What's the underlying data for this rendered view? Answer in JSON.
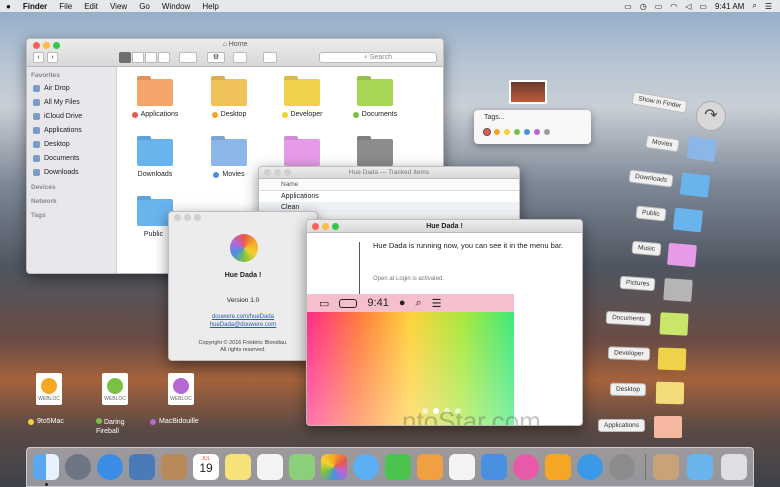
{
  "menubar": {
    "apple": "",
    "app": "Finder",
    "items": [
      "File",
      "Edit",
      "View",
      "Go",
      "Window",
      "Help"
    ],
    "time": "9:41 AM"
  },
  "finder": {
    "title": "Home",
    "search_placeholder": "Search",
    "sidebar": {
      "favorites_head": "Favorites",
      "favorites": [
        "Air Drop",
        "All My Files",
        "iCloud Drive",
        "Applications",
        "Desktop",
        "Documents",
        "Downloads"
      ],
      "devices_head": "Devices",
      "network_head": "Network",
      "tags_head": "Tags"
    },
    "folders": [
      {
        "label": "Applications",
        "color": "#f5a56a",
        "dot": "#e8574e"
      },
      {
        "label": "Desktop",
        "color": "#f0c35a",
        "dot": "#f5a623"
      },
      {
        "label": "Developer",
        "color": "#f0d24a",
        "dot": "#f2d230"
      },
      {
        "label": "Documents",
        "color": "#a6d653",
        "dot": "#7ac143"
      },
      {
        "label": "Downloads",
        "color": "#6ab4ee",
        "dot": ""
      },
      {
        "label": "Movies",
        "color": "#8bb7e8",
        "dot": "#4a90e2"
      },
      {
        "label": "",
        "color": "#e69be8",
        "dot": ""
      },
      {
        "label": "",
        "color": "#8c8c8c",
        "dot": ""
      },
      {
        "label": "Public",
        "color": "#6ab4ee",
        "dot": ""
      }
    ]
  },
  "tagged_window": {
    "title": "Hue Dada — Tracked Items",
    "col_header": "Name",
    "rows": [
      "Applications",
      "Clean"
    ]
  },
  "about": {
    "app_name": "Hue Dada !",
    "version": "Version 1.0",
    "link1": "douwere.com/hueDada",
    "link2": "hueDada@douwere.com",
    "copyright1": "Copyright © 2016 Frédéric Blondiau.",
    "copyright2": "All rights reserved."
  },
  "huewin": {
    "title": "Hue Dada !",
    "message": "Hue Dada is running now, you can see it in the menu bar.",
    "login_note": "Open at Login is activated.",
    "bar_time": "9:41",
    "watermark": "ntoStar.com"
  },
  "tags_popup": {
    "label": "Tags...",
    "colors": [
      "#e8574e",
      "#f5a623",
      "#f2d230",
      "#7ac143",
      "#4a90e2",
      "#b667d6",
      "#9b9b9b"
    ]
  },
  "show_in_finder": "Show in Finder",
  "stack": [
    {
      "label": "Movies",
      "color": "#8bb7e8"
    },
    {
      "label": "Downloads",
      "color": "#6ab4ee"
    },
    {
      "label": "Public",
      "color": "#6ab4ee"
    },
    {
      "label": "Music",
      "color": "#e69be8"
    },
    {
      "label": "Pictures",
      "color": "#b5b5b5"
    },
    {
      "label": "Documents",
      "color": "#c9e56a"
    },
    {
      "label": "Developer",
      "color": "#f0d24a"
    },
    {
      "label": "Desktop",
      "color": "#f5dc7a"
    },
    {
      "label": "Applications",
      "color": "#f5b7a0"
    }
  ],
  "desktop_files": [
    {
      "label": "9to5Mac",
      "ext": "WEBLOC",
      "dot": "#f2d230"
    },
    {
      "label": "Daring Fireball",
      "ext": "WEBLOC",
      "dot": "#7ac143"
    },
    {
      "label": "MacBidouille",
      "ext": "WEBLOC",
      "dot": "#b667d6"
    }
  ],
  "calendar": {
    "month": "JUL",
    "day": "19"
  }
}
